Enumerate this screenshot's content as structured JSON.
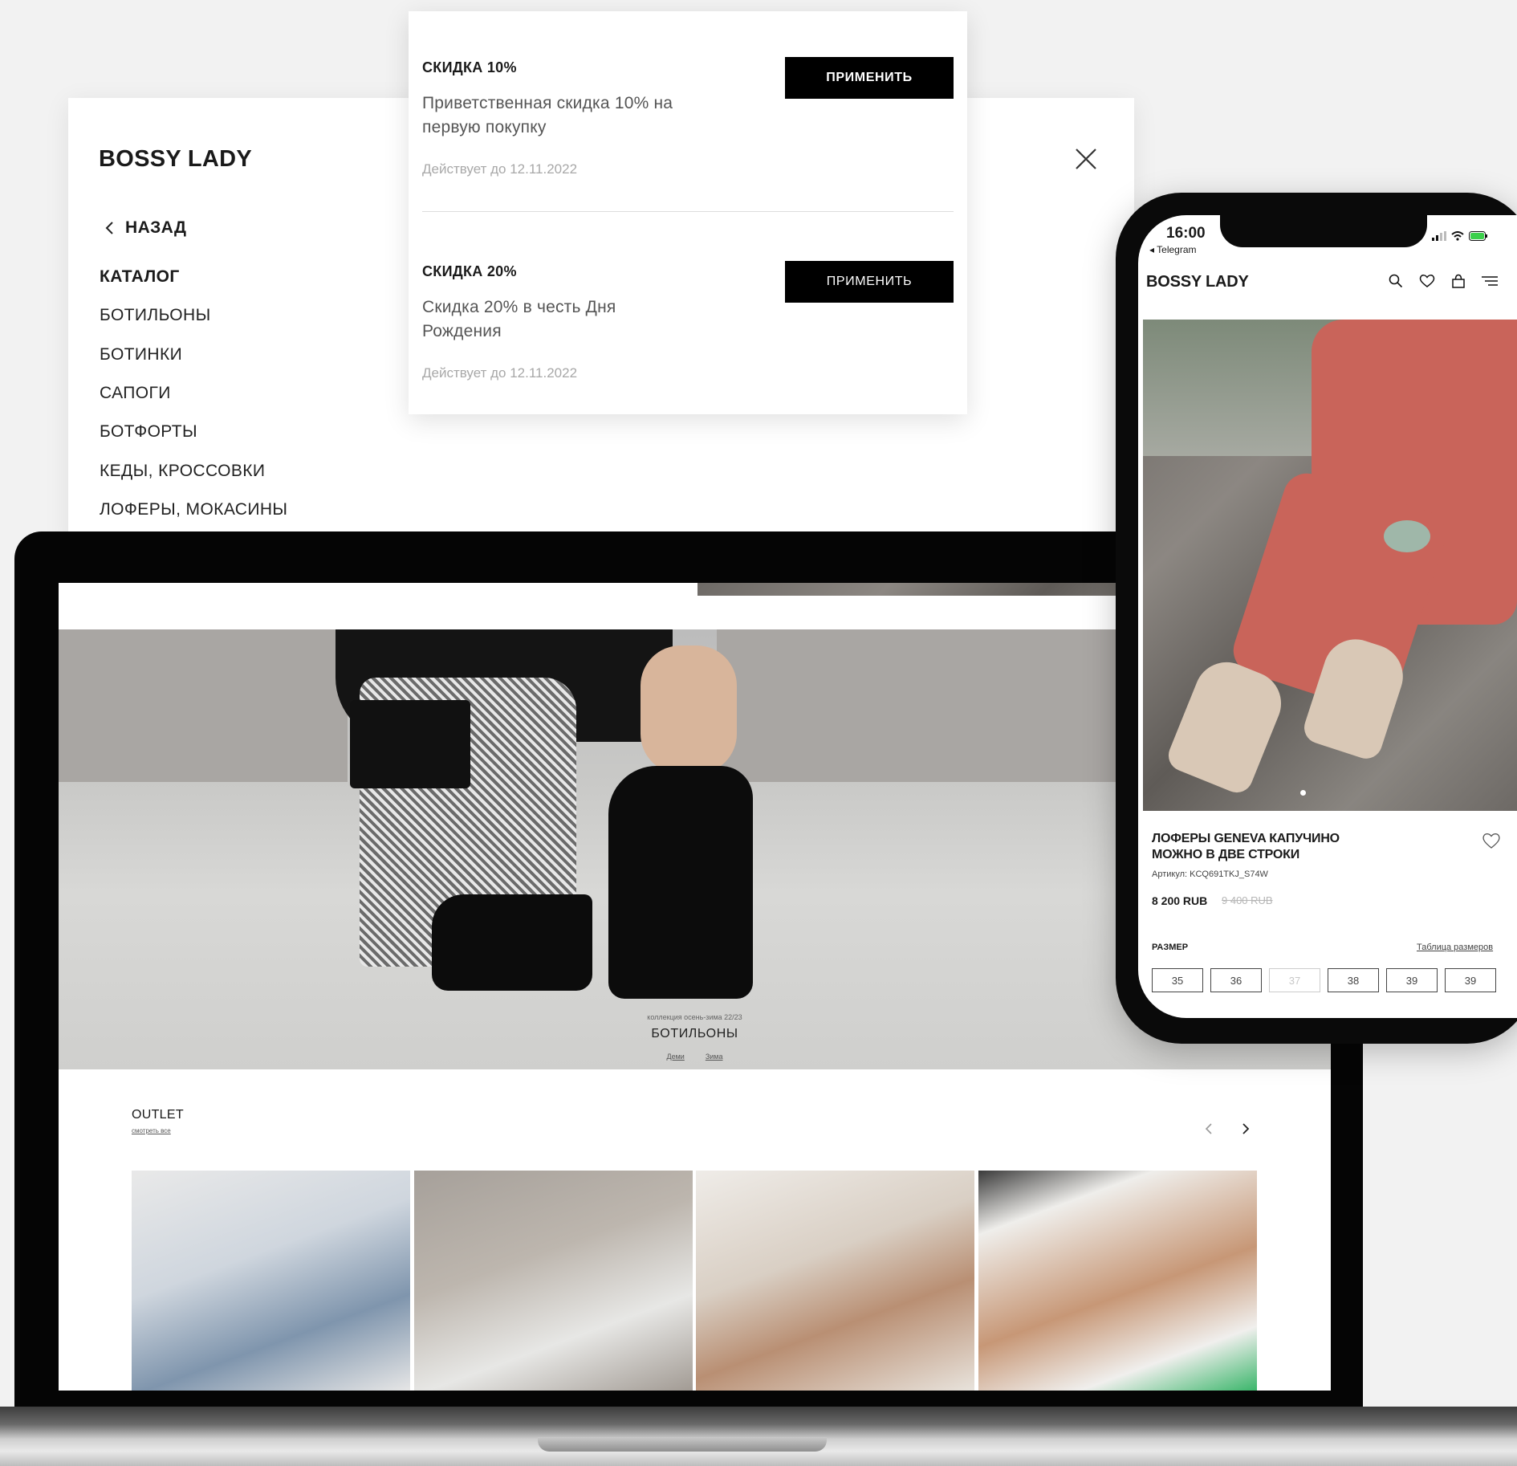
{
  "menu": {
    "brand": "BOSSY LADY",
    "back_label": "НАЗАД",
    "section": "КАТАЛОГ",
    "items": [
      "БОТИЛЬОНЫ",
      "БОТИНКИ",
      "САПОГИ",
      "БОТФОРТЫ",
      "КЕДЫ, КРОССОВКИ",
      "ЛОФЕРЫ, МОКАСИНЫ"
    ]
  },
  "promos": [
    {
      "title": "СКИДКА 10%",
      "desc_line1": "Приветственная скидка 10% на",
      "desc_line2": "первую покупку",
      "valid": "Действует до 12.11.2022",
      "button": "ПРИМЕНИТЬ"
    },
    {
      "title": "СКИДКА 20%",
      "desc_line1": "Скидка 20% в честь Дня",
      "desc_line2": "Рождения",
      "valid": "Действует до 12.11.2022",
      "button": "ПРИМЕНИТЬ"
    }
  ],
  "laptop": {
    "hero_caption": "коллекция осень-зима 22/23",
    "hero_title": "БОТИЛЬОНЫ",
    "hero_links": [
      "Деми",
      "Зима"
    ],
    "outlet_title": "OUTLET",
    "outlet_link": "смотреть все"
  },
  "phone": {
    "time": "16:00",
    "back_app": "◂ Telegram",
    "brand": "BOSSY LADY",
    "product_title_line1": "ЛОФЕРЫ GENEVA КАПУЧИНО",
    "product_title_line2": "МОЖНО В ДВЕ СТРОКИ",
    "sku": "Артикул: KCQ691TKJ_S74W",
    "price": "8 200 RUB",
    "old_price": "9 400 RUB",
    "size_label": "РАЗМЕР",
    "size_table_link": "Таблица размеров",
    "sizes": [
      "35",
      "36",
      "37",
      "38",
      "39",
      "39"
    ]
  },
  "colors": {
    "accent": "#000000",
    "background": "#f2f2f2",
    "muted": "#a8a8a8"
  },
  "icons": [
    "chevron-left-icon",
    "close-icon",
    "search-icon",
    "heart-icon",
    "bag-icon",
    "menu-icon",
    "chevron-right-icon",
    "wifi-icon",
    "battery-icon",
    "signal-icon"
  ]
}
